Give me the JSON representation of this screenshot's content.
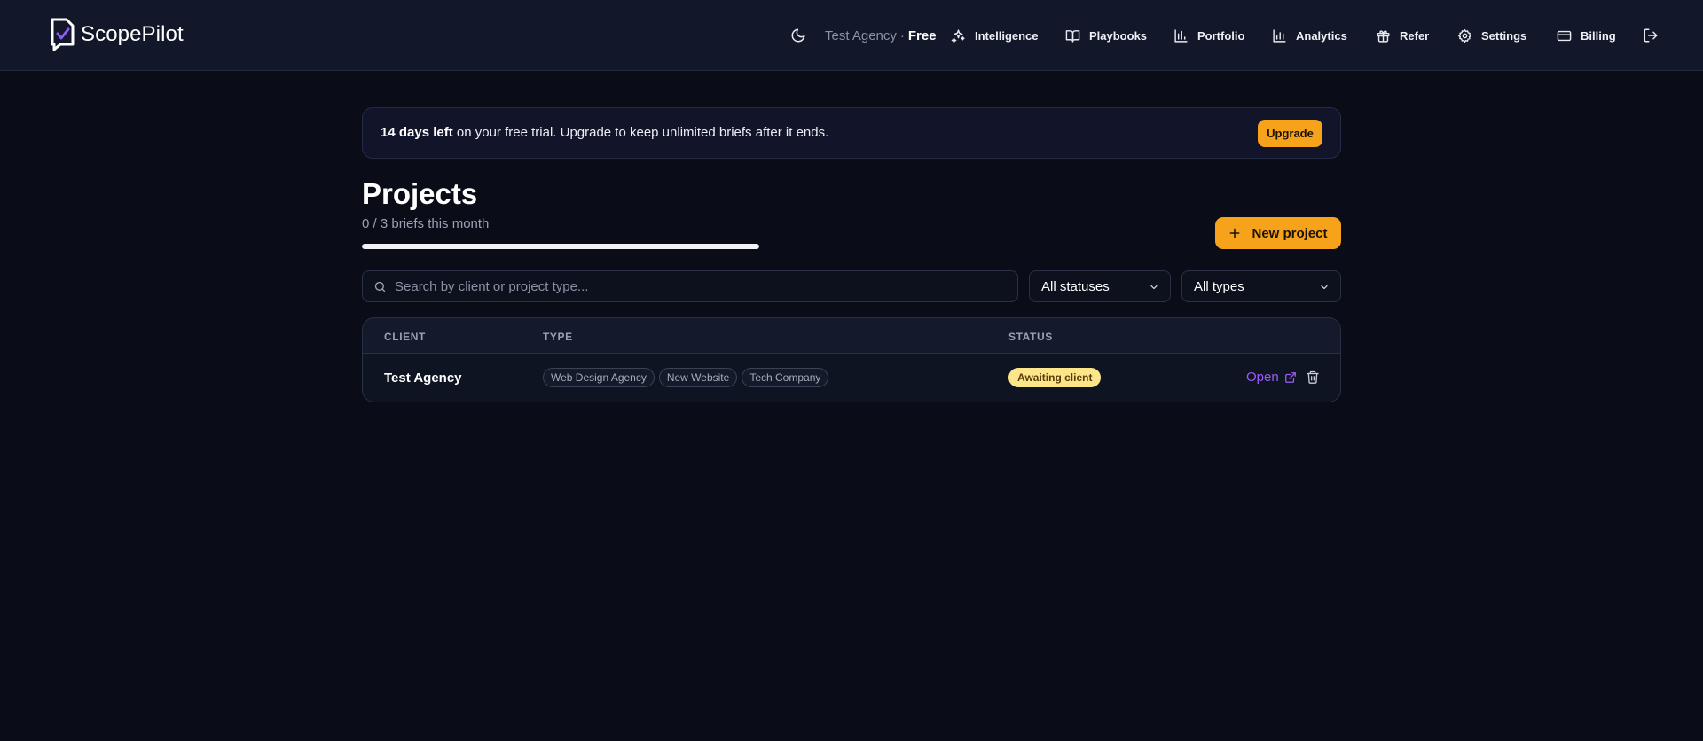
{
  "app": {
    "name": "ScopePilot"
  },
  "account": {
    "name": "Test Agency",
    "separator": "·",
    "plan": "Free"
  },
  "nav": {
    "items": [
      {
        "label": "Intelligence",
        "icon": "sparkles-icon"
      },
      {
        "label": "Playbooks",
        "icon": "book-open-icon"
      },
      {
        "label": "Portfolio",
        "icon": "bar-chart-icon"
      },
      {
        "label": "Analytics",
        "icon": "bar-chart-2-icon"
      },
      {
        "label": "Refer",
        "icon": "gift-icon"
      },
      {
        "label": "Settings",
        "icon": "gear-icon"
      },
      {
        "label": "Billing",
        "icon": "credit-card-icon"
      }
    ],
    "theme_icon": "moon-icon",
    "logout_icon": "log-out-icon"
  },
  "banner": {
    "highlight": "14 days left",
    "text": " on your free trial. Upgrade to keep unlimited briefs after it ends.",
    "upgrade_label": "Upgrade"
  },
  "page": {
    "title": "Projects",
    "usage_text": "0 / 3 briefs this month",
    "usage_fraction": 1.0,
    "new_project_label": "New project"
  },
  "filters": {
    "search_placeholder": "Search by client or project type...",
    "status_value": "All statuses",
    "type_value": "All types"
  },
  "table": {
    "columns": [
      "CLIENT",
      "TYPE",
      "STATUS"
    ],
    "rows": [
      {
        "client": "Test Agency",
        "tags": [
          "Web Design Agency",
          "New Website",
          "Tech Company"
        ],
        "status": "Awaiting client",
        "open_label": "Open"
      }
    ]
  },
  "colors": {
    "accent": "#f7a21b",
    "link": "#9b5cf6",
    "status_awaiting": "#fde68a",
    "background": "#0a0d17"
  }
}
